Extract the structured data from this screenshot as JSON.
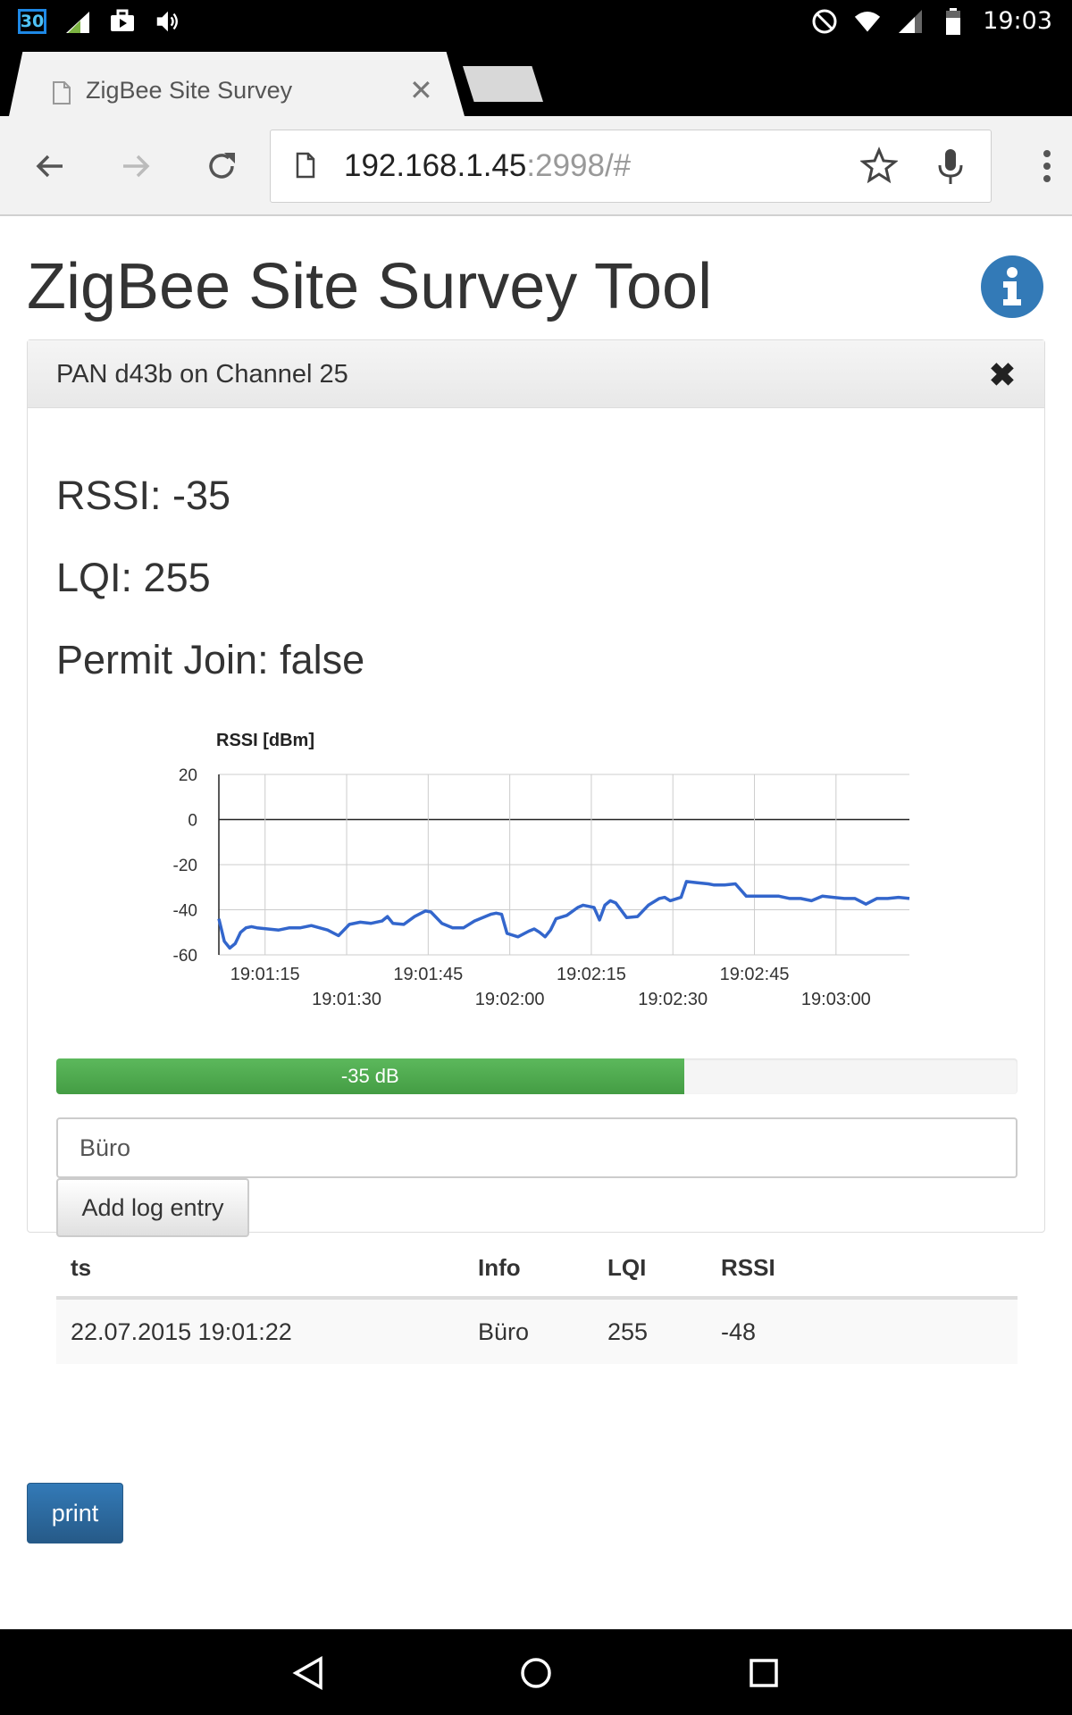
{
  "status_bar": {
    "calendar_day": "30",
    "time": "19:03",
    "icons": [
      "calendar-icon",
      "data-icon",
      "briefcase-icon",
      "vibrate-icon",
      "do-not-disturb-icon",
      "wifi-icon",
      "cell-signal-icon",
      "battery-icon"
    ]
  },
  "browser": {
    "tab_title": "ZigBee Site Survey",
    "url_host": "192.168.1.45",
    "url_rest": ":2998/#"
  },
  "page": {
    "title": "ZigBee Site Survey Tool",
    "panel_title": "PAN d43b on Channel 25",
    "rssi_text": "RSSI: -35",
    "lqi_text": "LQI: 255",
    "permit_join_text": "Permit Join: false",
    "progress": {
      "label": "-35 dB",
      "fraction": 0.653,
      "color": "#5cb85c"
    },
    "log_input_value": "Büro",
    "add_button_label": "Add log entry",
    "print_button_label": "print",
    "table": {
      "headers": [
        "ts",
        "Info",
        "LQI",
        "RSSI"
      ],
      "rows": [
        [
          "22.07.2015 19:01:22",
          "Büro",
          "255",
          "-48"
        ]
      ]
    }
  },
  "chart_data": {
    "type": "line",
    "ylabel": "RSSI [dBm]",
    "ylim": [
      -60,
      20
    ],
    "yticks": [
      20,
      0,
      -20,
      -40,
      -60
    ],
    "x_tick_labels": [
      "19:01:15",
      "19:01:30",
      "19:01:45",
      "19:02:00",
      "19:02:15",
      "19:02:30",
      "19:02:45",
      "19:03:00"
    ],
    "x_tick_seconds": [
      75,
      90,
      105,
      120,
      135,
      150,
      165,
      180
    ],
    "xlim_seconds": [
      66.5,
      193.5
    ],
    "grid": true,
    "line_color": "#3366cc",
    "series": [
      {
        "x": [
          66.5,
          67.5,
          68.5,
          69.5,
          70.5,
          71.5,
          72.5,
          73.5,
          75.5,
          77.5,
          79.5,
          81.5,
          83.5,
          86.5,
          88.5,
          90.5,
          92.5,
          94.5,
          96.5,
          97.5,
          98.5,
          100.5,
          102.5,
          104.5,
          105.5,
          107.5,
          109.5,
          111.5,
          113.5,
          115.5,
          116.5,
          117.5,
          118.5,
          119.5,
          121.5,
          123.5,
          124.5,
          125.5,
          126.5,
          127.5,
          128.5,
          130.5,
          132.5,
          133.5,
          134.5,
          135.5,
          136.5,
          137.5,
          138.5,
          139.5,
          141.5,
          143.5,
          145.5,
          147.5,
          148.5,
          149.5,
          151.5,
          152.5,
          154.5,
          156.5,
          157.5,
          159.5,
          161.5,
          163.5,
          165.5,
          166.5,
          167.5,
          169.5,
          171.5,
          173.5,
          175.5,
          177.5,
          179.5,
          181.5,
          182.5,
          183.5,
          185.5,
          187.5,
          189.5,
          191.5,
          193.5
        ],
        "y": [
          -44,
          -54,
          -57,
          -55,
          -50,
          -48,
          -47.5,
          -48,
          -48.5,
          -49,
          -48,
          -48,
          -47,
          -49,
          -51.5,
          -46.5,
          -45.5,
          -46,
          -45,
          -43,
          -46,
          -46.5,
          -43,
          -40.5,
          -41,
          -46,
          -48,
          -48,
          -45,
          -43,
          -42,
          -41.5,
          -42,
          -50.5,
          -52,
          -49.5,
          -48.5,
          -50,
          -52,
          -49,
          -44,
          -42.5,
          -39,
          -38,
          -38.5,
          -39,
          -44.5,
          -38,
          -36,
          -37,
          -43.5,
          -43,
          -38,
          -35,
          -34.5,
          -36,
          -34.5,
          -27.5,
          -28,
          -28.5,
          -29,
          -29,
          -28.5,
          -34,
          -34,
          -34,
          -34,
          -34,
          -35,
          -35,
          -36,
          -34,
          -34.5,
          -35,
          -35,
          -35,
          -37.5,
          -35,
          -35,
          -34.5,
          -35
        ]
      }
    ]
  }
}
